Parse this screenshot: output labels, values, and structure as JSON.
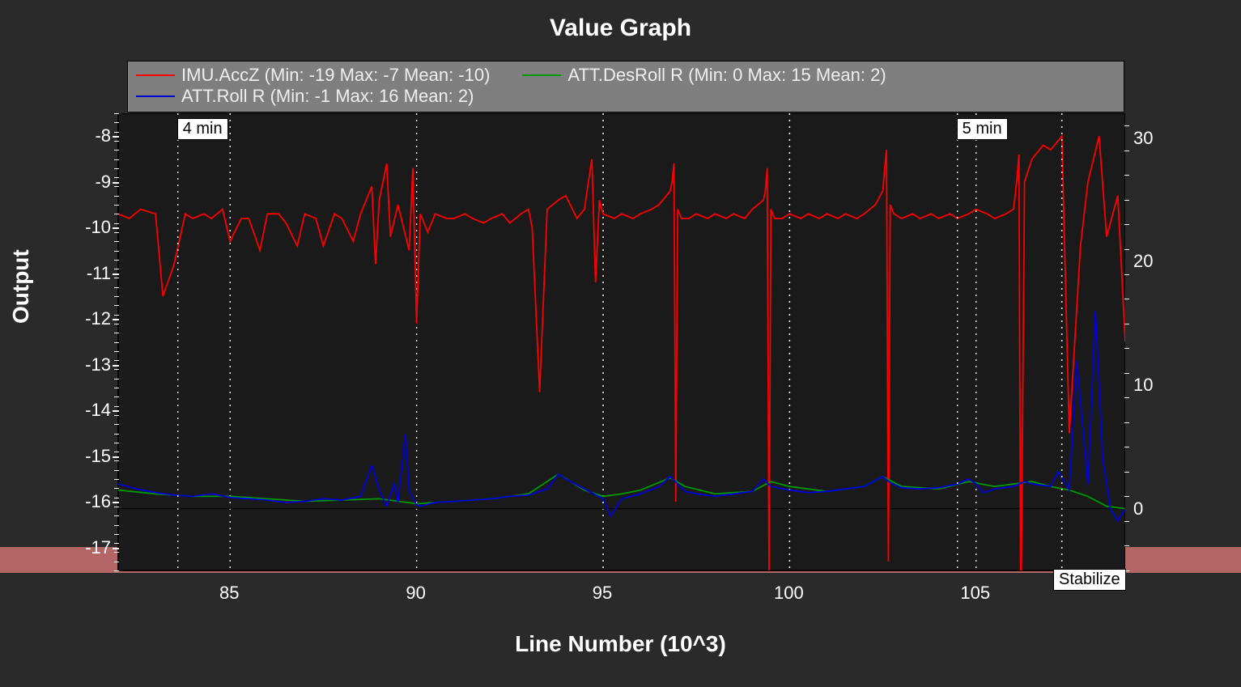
{
  "chart_data": {
    "type": "line",
    "title": "Value Graph",
    "xlabel": "Line Number (10^3)",
    "ylabel": "Output",
    "xlim": [
      82,
      109
    ],
    "x_ticks": [
      85,
      90,
      95,
      100,
      105
    ],
    "y_left": {
      "lim": [
        -17.5,
        -7.5
      ],
      "ticks": [
        -8,
        -9,
        -10,
        -11,
        -12,
        -13,
        -14,
        -15,
        -16,
        -17
      ]
    },
    "y_right": {
      "lim": [
        -5,
        32
      ],
      "ticks": [
        0,
        10,
        20,
        30
      ]
    },
    "time_markers": [
      {
        "label": "4 min",
        "x": 83.6
      },
      {
        "label": "5 min",
        "x": 104.5
      }
    ],
    "mode_label": {
      "text": "Stabilize",
      "x": 107.3
    },
    "pink_band_y_left": -17,
    "grid_x": [
      85,
      90,
      95,
      100,
      105
    ],
    "zero_line_y_right": 0,
    "series": [
      {
        "name": "IMU.AccZ",
        "legend": "IMU.AccZ (Min: -19 Max: -7 Mean: -10)",
        "color": "#ff0000",
        "axis": "left",
        "x": [
          82,
          82.3,
          82.6,
          83,
          83.2,
          83.5,
          83.8,
          84,
          84.3,
          84.5,
          84.8,
          85,
          85.3,
          85.5,
          85.8,
          86,
          86.3,
          86.5,
          86.8,
          87,
          87.3,
          87.5,
          87.8,
          88,
          88.3,
          88.5,
          88.8,
          88.9,
          89,
          89.2,
          89.3,
          89.5,
          89.8,
          89.9,
          90,
          90.1,
          90.3,
          90.5,
          90.8,
          91,
          91.3,
          91.5,
          91.8,
          92,
          92.3,
          92.5,
          92.8,
          93,
          93.1,
          93.3,
          93.5,
          93.8,
          94,
          94.3,
          94.5,
          94.7,
          94.8,
          94.9,
          95,
          95.3,
          95.5,
          95.8,
          96,
          96.3,
          96.5,
          96.8,
          96.85,
          96.9,
          96.95,
          97,
          97.1,
          97.3,
          97.5,
          97.8,
          98,
          98.3,
          98.5,
          98.8,
          99,
          99.3,
          99.35,
          99.4,
          99.45,
          99.5,
          99.6,
          99.8,
          100,
          100.3,
          100.5,
          100.8,
          101,
          101.3,
          101.5,
          101.8,
          102,
          102.3,
          102.5,
          102.55,
          102.6,
          102.65,
          102.7,
          102.8,
          103,
          103.3,
          103.5,
          103.8,
          104,
          104.3,
          104.5,
          104.8,
          105,
          105.3,
          105.5,
          105.8,
          106,
          106.05,
          106.1,
          106.15,
          106.2,
          106.3,
          106.5,
          106.8,
          107,
          107.3,
          107.5,
          107.8,
          108,
          108.3,
          108.5,
          108.8,
          109
        ],
        "y": [
          -9.7,
          -9.8,
          -9.6,
          -9.7,
          -11.5,
          -10.8,
          -9.7,
          -9.8,
          -9.7,
          -9.8,
          -9.6,
          -10.3,
          -9.8,
          -9.8,
          -10.5,
          -9.7,
          -9.7,
          -9.9,
          -10.4,
          -9.7,
          -9.8,
          -10.4,
          -9.7,
          -9.8,
          -10.3,
          -9.7,
          -9.1,
          -10.8,
          -9.4,
          -8.6,
          -10.2,
          -9.5,
          -10.5,
          -8.7,
          -12.1,
          -9.7,
          -10.1,
          -9.7,
          -9.8,
          -9.8,
          -9.7,
          -9.8,
          -9.9,
          -9.8,
          -9.7,
          -9.9,
          -9.7,
          -9.6,
          -10.0,
          -13.6,
          -9.6,
          -9.4,
          -9.3,
          -9.8,
          -9.6,
          -8.5,
          -11.2,
          -9.4,
          -9.7,
          -9.8,
          -9.7,
          -9.8,
          -9.7,
          -9.6,
          -9.5,
          -9.2,
          -9.0,
          -8.6,
          -16.0,
          -9.6,
          -9.8,
          -9.8,
          -9.7,
          -9.8,
          -9.7,
          -9.8,
          -9.7,
          -9.8,
          -9.6,
          -9.4,
          -9.2,
          -8.7,
          -17.5,
          -9.6,
          -9.8,
          -9.8,
          -9.7,
          -9.8,
          -9.7,
          -9.8,
          -9.7,
          -9.8,
          -9.7,
          -9.8,
          -9.7,
          -9.5,
          -9.2,
          -8.7,
          -8.3,
          -17.3,
          -9.5,
          -9.7,
          -9.8,
          -9.7,
          -9.8,
          -9.7,
          -9.8,
          -9.7,
          -9.8,
          -9.7,
          -9.6,
          -9.7,
          -9.8,
          -9.7,
          -9.6,
          -9.3,
          -8.9,
          -8.4,
          -19.0,
          -9.0,
          -8.5,
          -8.2,
          -8.3,
          -8.0,
          -14.5,
          -10.4,
          -9.0,
          -8.0,
          -10.2,
          -9.3,
          -12.5,
          -10.2
        ]
      },
      {
        "name": "ATT.DesRoll",
        "legend": "ATT.DesRoll R (Min: 0 Max: 15 Mean: 2)",
        "color": "#009900",
        "axis": "right",
        "x": [
          82,
          83,
          84,
          85,
          86,
          87,
          88,
          89,
          90,
          91,
          92,
          93,
          93.8,
          94.5,
          95,
          95.5,
          96,
          96.8,
          97.2,
          98,
          99,
          99.5,
          100,
          101,
          102,
          102.5,
          103,
          104,
          104.8,
          105.5,
          106,
          106.5,
          107,
          107.5,
          108,
          108.5,
          109
        ],
        "y": [
          1.5,
          1.2,
          1,
          1,
          0.8,
          0.6,
          0.7,
          0.8,
          0.4,
          0.6,
          0.8,
          1.2,
          2.8,
          1.5,
          1,
          1.2,
          1.5,
          2.5,
          1.8,
          1.2,
          1.4,
          2.2,
          1.8,
          1.4,
          1.8,
          2.6,
          1.8,
          1.6,
          2.2,
          1.8,
          2,
          2.2,
          1.8,
          1.5,
          1,
          0.2,
          0
        ]
      },
      {
        "name": "ATT.Roll",
        "legend": "ATT.Roll R (Min: -1 Max: 16 Mean: 2)",
        "color": "#0000dd",
        "axis": "right",
        "x": [
          82,
          82.5,
          83,
          83.5,
          84,
          84.5,
          85,
          85.5,
          86,
          86.5,
          87,
          87.5,
          88,
          88.5,
          88.8,
          89,
          89.2,
          89.4,
          89.5,
          89.7,
          89.8,
          90,
          90.1,
          90.5,
          91,
          91.5,
          92,
          92.5,
          93,
          93.5,
          93.8,
          94,
          94.5,
          95,
          95.2,
          95.5,
          96,
          96.5,
          96.8,
          97,
          97.2,
          97.5,
          98,
          98.5,
          99,
          99.3,
          99.5,
          100,
          100.5,
          101,
          101.5,
          102,
          102.5,
          102.7,
          103,
          103.5,
          104,
          104.5,
          104.8,
          105,
          105.2,
          105.5,
          106,
          106.3,
          106.5,
          107,
          107.2,
          107.5,
          107.7,
          108,
          108.2,
          108.4,
          108.6,
          108.8,
          109
        ],
        "y": [
          2,
          1.6,
          1.3,
          1.1,
          1.0,
          1.2,
          0.9,
          0.8,
          0.7,
          0.5,
          0.6,
          0.8,
          0.7,
          1.0,
          3.5,
          1.5,
          0.2,
          2.0,
          0.5,
          6.0,
          1.5,
          0.3,
          0.2,
          0.5,
          0.6,
          0.7,
          0.8,
          1.0,
          1.1,
          1.6,
          2.8,
          2.4,
          1.6,
          0.8,
          -0.6,
          0.8,
          1.2,
          1.8,
          2.6,
          2.0,
          1.4,
          1.2,
          1.0,
          1.2,
          1.4,
          2.4,
          1.8,
          1.5,
          1.3,
          1.4,
          1.6,
          1.8,
          2.6,
          2.1,
          1.7,
          1.6,
          1.7,
          2.0,
          2.4,
          2.0,
          1.3,
          1.6,
          1.8,
          2.2,
          2.0,
          1.8,
          3.0,
          1.5,
          12.0,
          2.0,
          16.0,
          4.0,
          0.0,
          -1.0,
          0
        ]
      }
    ]
  }
}
